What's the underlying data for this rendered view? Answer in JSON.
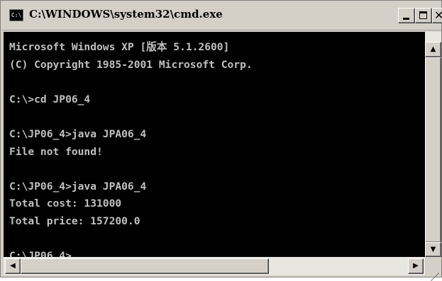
{
  "window": {
    "title": "C:\\WINDOWS\\system32\\cmd.exe",
    "icon_text": "C:\\"
  },
  "titlebar_buttons": {
    "close_glyph": "✕"
  },
  "console": {
    "lines": [
      "Microsoft Windows XP [版本 5.1.2600]",
      "(C) Copyright 1985-2001 Microsoft Corp.",
      "",
      "C:\\>cd JP06_4",
      "",
      "C:\\JP06_4>java JPA06_4",
      "File not found!",
      "",
      "C:\\JP06_4>java JPA06_4",
      "Total cost: 131000",
      "Total price: 157200.0",
      "",
      "C:\\JP06_4>"
    ]
  },
  "scrollbar": {
    "up_glyph": "▲",
    "down_glyph": "▼",
    "left_glyph": "◀",
    "right_glyph": "▶"
  },
  "colors": {
    "console_bg": "#000000",
    "console_fg": "#c0c0c0",
    "chrome": "#d4d0c8"
  }
}
